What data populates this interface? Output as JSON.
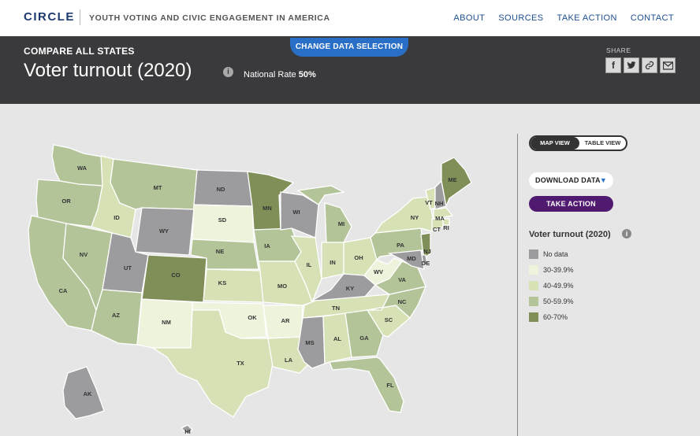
{
  "nav": {
    "logo": "CIRCLE",
    "tagline": "YOUTH VOTING AND CIVIC ENGAGEMENT IN AMERICA",
    "links": [
      "ABOUT",
      "SOURCES",
      "TAKE ACTION",
      "CONTACT"
    ]
  },
  "header": {
    "eyebrow": "COMPARE ALL STATES",
    "title": "Voter turnout (2020)",
    "info_icon": "i",
    "national_rate_label": "National Rate",
    "national_rate_value": "50%",
    "change_button": "CHANGE DATA SELECTION",
    "share_label": "SHARE",
    "share_icons": [
      "facebook-icon",
      "twitter-icon",
      "link-icon",
      "email-icon"
    ]
  },
  "panel": {
    "map_view": "MAP VIEW",
    "table_view": "TABLE VIEW",
    "download": "DOWNLOAD DATA",
    "take_action": "TAKE ACTION",
    "legend_title": "Voter turnout (2020)",
    "legend": [
      {
        "label": "No data",
        "color": "#9c9c9e"
      },
      {
        "label": "30-39.9%",
        "color": "#eef3dc"
      },
      {
        "label": "40-49.9%",
        "color": "#d6e2b6"
      },
      {
        "label": "50-59.9%",
        "color": "#b4c499"
      },
      {
        "label": "60-70%",
        "color": "#7f8f57"
      }
    ]
  },
  "map": {
    "states": [
      {
        "abbr": "WA",
        "bucket": "50-59.9%"
      },
      {
        "abbr": "OR",
        "bucket": "50-59.9%"
      },
      {
        "abbr": "CA",
        "bucket": "50-59.9%"
      },
      {
        "abbr": "NV",
        "bucket": "50-59.9%"
      },
      {
        "abbr": "ID",
        "bucket": "40-49.9%"
      },
      {
        "abbr": "MT",
        "bucket": "50-59.9%"
      },
      {
        "abbr": "WY",
        "bucket": "No data"
      },
      {
        "abbr": "UT",
        "bucket": "No data"
      },
      {
        "abbr": "AZ",
        "bucket": "50-59.9%"
      },
      {
        "abbr": "CO",
        "bucket": "60-70%"
      },
      {
        "abbr": "NM",
        "bucket": "30-39.9%"
      },
      {
        "abbr": "ND",
        "bucket": "No data"
      },
      {
        "abbr": "SD",
        "bucket": "30-39.9%"
      },
      {
        "abbr": "NE",
        "bucket": "50-59.9%"
      },
      {
        "abbr": "KS",
        "bucket": "40-49.9%"
      },
      {
        "abbr": "OK",
        "bucket": "30-39.9%"
      },
      {
        "abbr": "TX",
        "bucket": "40-49.9%"
      },
      {
        "abbr": "MN",
        "bucket": "60-70%"
      },
      {
        "abbr": "IA",
        "bucket": "50-59.9%"
      },
      {
        "abbr": "MO",
        "bucket": "40-49.9%"
      },
      {
        "abbr": "AR",
        "bucket": "30-39.9%"
      },
      {
        "abbr": "LA",
        "bucket": "40-49.9%"
      },
      {
        "abbr": "WI",
        "bucket": "No data"
      },
      {
        "abbr": "IL",
        "bucket": "40-49.9%"
      },
      {
        "abbr": "MI",
        "bucket": "50-59.9%"
      },
      {
        "abbr": "IN",
        "bucket": "40-49.9%"
      },
      {
        "abbr": "OH",
        "bucket": "40-49.9%"
      },
      {
        "abbr": "KY",
        "bucket": "No data"
      },
      {
        "abbr": "TN",
        "bucket": "40-49.9%"
      },
      {
        "abbr": "MS",
        "bucket": "No data"
      },
      {
        "abbr": "AL",
        "bucket": "40-49.9%"
      },
      {
        "abbr": "GA",
        "bucket": "50-59.9%"
      },
      {
        "abbr": "FL",
        "bucket": "50-59.9%"
      },
      {
        "abbr": "SC",
        "bucket": "40-49.9%"
      },
      {
        "abbr": "NC",
        "bucket": "50-59.9%"
      },
      {
        "abbr": "VA",
        "bucket": "50-59.9%"
      },
      {
        "abbr": "WV",
        "bucket": "30-39.9%"
      },
      {
        "abbr": "PA",
        "bucket": "50-59.9%"
      },
      {
        "abbr": "NY",
        "bucket": "40-49.9%"
      },
      {
        "abbr": "VT",
        "bucket": "40-49.9%"
      },
      {
        "abbr": "NH",
        "bucket": "No data"
      },
      {
        "abbr": "ME",
        "bucket": "60-70%"
      },
      {
        "abbr": "MA",
        "bucket": "40-49.9%"
      },
      {
        "abbr": "RI",
        "bucket": "40-49.9%"
      },
      {
        "abbr": "CT",
        "bucket": "40-49.9%"
      },
      {
        "abbr": "NJ",
        "bucket": "60-70%"
      },
      {
        "abbr": "DE",
        "bucket": "No data"
      },
      {
        "abbr": "MD",
        "bucket": "No data"
      },
      {
        "abbr": "AK",
        "bucket": "No data"
      },
      {
        "abbr": "HI",
        "bucket": "No data"
      }
    ]
  }
}
